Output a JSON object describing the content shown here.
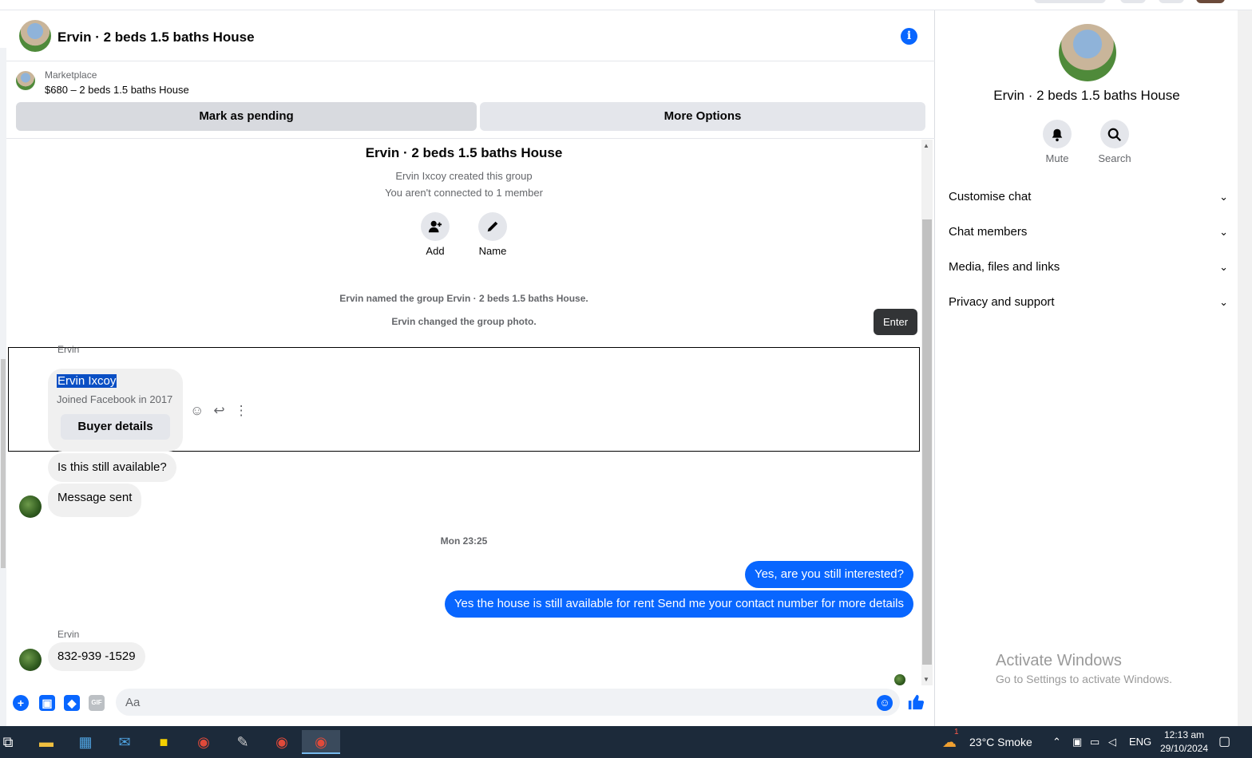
{
  "chat": {
    "title": "Ervin · 2 beds 1.5 baths House",
    "info_icon": "i"
  },
  "marketplace": {
    "label": "Marketplace",
    "listing": "$680 – 2 beds 1.5 baths House",
    "mark_pending": "Mark as pending",
    "more_options": "More Options"
  },
  "group": {
    "title": "Ervin · 2 beds 1.5 baths House",
    "created": "Ervin Ixcoy created this group",
    "connection": "You aren't connected to 1 member",
    "add_label": "Add",
    "name_label": "Name",
    "named_event": "Ervin named the group Ervin · 2 beds 1.5 baths House.",
    "photo_event": "Ervin changed the group photo."
  },
  "tooltip": "Enter",
  "card": {
    "sender": "Ervin",
    "name": "Ervin Ixcoy",
    "joined": "Joined Facebook in 2017",
    "buyer_button": "Buyer details"
  },
  "messages": {
    "in1": "Is this still available?",
    "in2": "Message sent",
    "timestamp": "Mon 23:25",
    "out1": "Yes, are you still interested?",
    "out2": "Yes the house is still available for rent Send me your contact number for more details",
    "sender2": "Ervin",
    "in3": "832-939 -1529"
  },
  "composer": {
    "placeholder": "Aa",
    "gif": "GIF"
  },
  "right_panel": {
    "title": "Ervin · 2 beds 1.5 baths House",
    "mute": "Mute",
    "search": "Search",
    "sections": [
      "Customise chat",
      "Chat members",
      "Media, files and links",
      "Privacy and support"
    ]
  },
  "watermark": {
    "line1": "Activate Windows",
    "line2": "Go to Settings to activate Windows."
  },
  "taskbar": {
    "weather": "23°C Smoke",
    "weather_badge": "1",
    "lang": "ENG",
    "time": "12:13 am",
    "date": "29/10/2024"
  },
  "colors": {
    "accent": "#0866ff",
    "taskbar": "#1c2a3a"
  }
}
